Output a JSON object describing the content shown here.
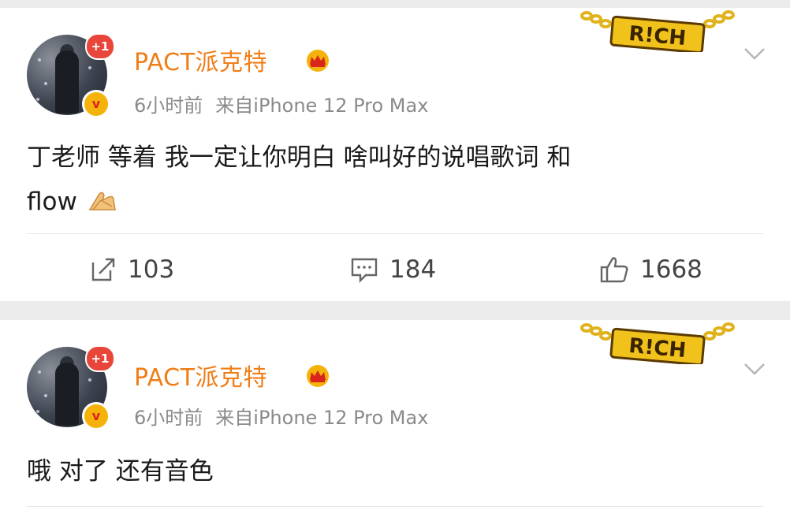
{
  "posts": [
    {
      "username": "PACT派克特",
      "plus_badge": "+1",
      "verified_badge": "v",
      "time": "6小时前",
      "source": "来自iPhone 12 Pro Max",
      "content_line1": "丁老师 等着 我一定让你明白 啥叫好的说唱歌词 和",
      "content_line2": "flow",
      "emoji": "pray-hands-icon",
      "repost_count": "103",
      "comment_count": "184",
      "like_count": "1668",
      "badge_text": "R!CH"
    },
    {
      "username": "PACT派克特",
      "plus_badge": "+1",
      "verified_badge": "v",
      "time": "6小时前",
      "source": "来自iPhone 12 Pro Max",
      "content_line1": "哦 对了 还有音色",
      "badge_text": "R!CH"
    }
  ],
  "colors": {
    "username": "#f07d16",
    "meta": "#8a8a8a",
    "badge_red": "#e8463a",
    "verified_gold": "#f5b20a"
  },
  "icons": {
    "crown": "crown-icon",
    "chevron": "chevron-down-icon",
    "repost": "repost-icon",
    "comment": "comment-icon",
    "like": "thumbs-up-icon"
  }
}
